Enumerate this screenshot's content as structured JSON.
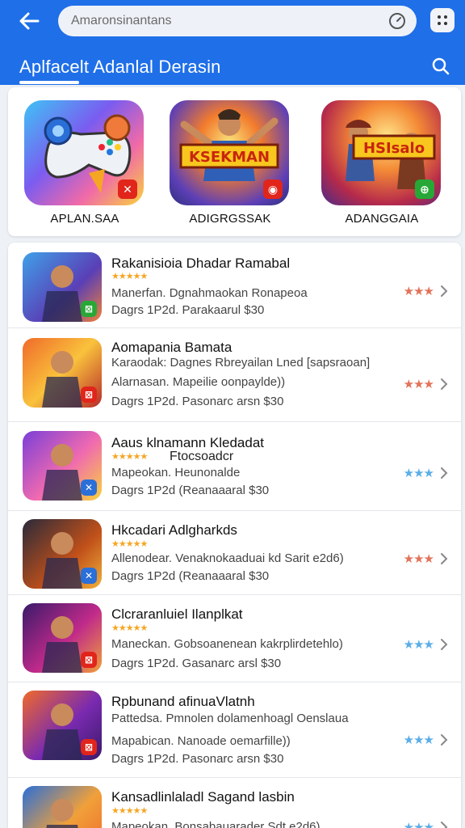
{
  "header": {
    "search_placeholder": "Amaronsinantans",
    "title": "Aplfacelt Adanlal Derasin"
  },
  "featured": [
    {
      "label": "APLAN.SAA",
      "icon": "gamepad-icon",
      "badge": "✕",
      "badge_color": "#e1251b"
    },
    {
      "label": "ADIGRGSSAK",
      "icon": "hero-art-icon",
      "badge": "◉",
      "badge_color": "#e1251b"
    },
    {
      "label": "ADANGGAIA",
      "icon": "hero-art-icon",
      "badge": "⊕",
      "badge_color": "#27a836"
    }
  ],
  "apps": [
    {
      "title": "Rakanisioia Dhadar Ramabal",
      "stars": "★★★★★",
      "tag": "",
      "line1": "Manerfan. Dgnahmaokan Ronapeoa",
      "line2": "",
      "price": "Dagrs 1P2d. Parakaarul $30",
      "rating": "★★★",
      "rating_color": "#e2735a",
      "badge": "⊠",
      "badge_color": "#27a836"
    },
    {
      "title": "Aomapania Bamata",
      "stars": "",
      "tag": "",
      "line1": "Karaodak: Dagnes Rbreyailan Lned [sapsraoan]",
      "line2": "Alarnasan. Mapeilie oonpaylde))",
      "price": "Dagrs 1P2d. Pasonarc arsn $30",
      "rating": "★★★",
      "rating_color": "#e2735a",
      "badge": "⊠",
      "badge_color": "#e1251b"
    },
    {
      "title": "Aaus klnamann Kledadat",
      "stars": "★★★★★",
      "tag": "Ftocsoadcr",
      "line1": "Mapeokan. Heunonalde",
      "line2": "",
      "price": "Dagrs 1P2d (Reanaaaral $30",
      "rating": "★★★",
      "rating_color": "#5aaee8",
      "badge": "✕",
      "badge_color": "#2b6fd8"
    },
    {
      "title": "Hkcadari Adlgharkds",
      "stars": "★★★★★",
      "tag": "",
      "line1": "Allenodear. Venaknokaaduai kd Sarit e2d6)",
      "line2": "",
      "price": "Dagrs 1P2d (Reanaaaral $30",
      "rating": "★★★",
      "rating_color": "#e2735a",
      "badge": "✕",
      "badge_color": "#2b6fd8"
    },
    {
      "title": "Clcraranluiel Ilanplkat",
      "stars": "★★★★★",
      "tag": "",
      "line1": "Maneckan. Gobsoanenean kakrplirdetehlo)",
      "line2": "",
      "price": "Dagrs 1P2d. Gasanarc arsl $30",
      "rating": "★★★",
      "rating_color": "#5aaee8",
      "badge": "⊠",
      "badge_color": "#e1251b"
    },
    {
      "title": "Rpbunand afinuaVlatnh",
      "stars": "",
      "tag": "",
      "line1": "Pattedsa. Pmnolen dolamenhoagl Oenslaua",
      "line2": "Mapabican. Nanoade oemarfille))",
      "price": "Dagrs 1P2d. Pasonarc arsn $30",
      "rating": "★★★",
      "rating_color": "#5aaee8",
      "badge": "⊠",
      "badge_color": "#e1251b"
    },
    {
      "title": "Kansadlinlaladl Sagand lasbin",
      "stars": "★★★★★",
      "tag": "",
      "line1": "Mapeokan. Bonsabauarader Sdt e2d6)",
      "line2": "",
      "price": "",
      "rating": "★★★",
      "rating_color": "#5aaee8",
      "badge": "",
      "badge_color": "#e1251b"
    }
  ]
}
